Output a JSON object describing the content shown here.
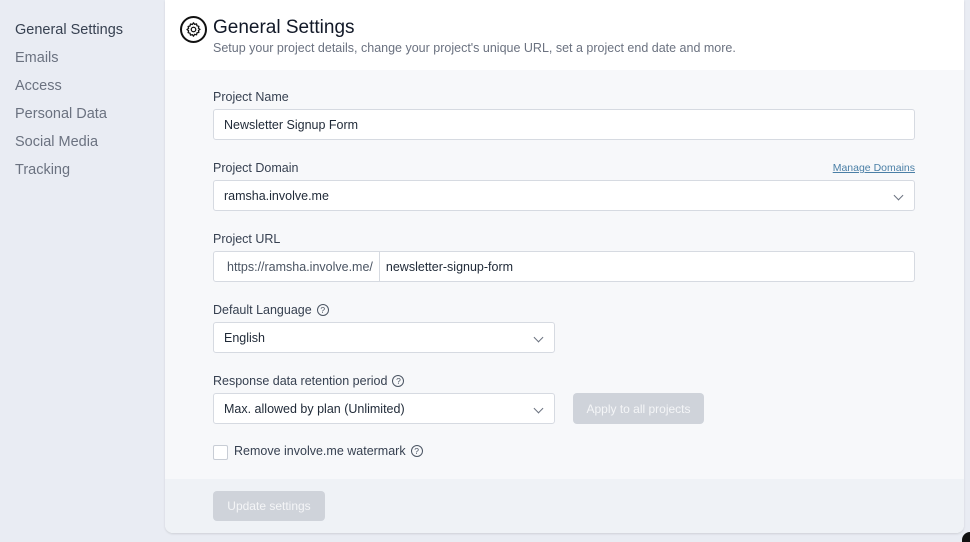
{
  "sidebar": {
    "items": [
      {
        "label": "General Settings",
        "active": true
      },
      {
        "label": "Emails",
        "active": false
      },
      {
        "label": "Access",
        "active": false
      },
      {
        "label": "Personal Data",
        "active": false
      },
      {
        "label": "Social Media",
        "active": false
      },
      {
        "label": "Tracking",
        "active": false
      }
    ]
  },
  "header": {
    "icon": "gear-icon",
    "title": "General Settings",
    "subtitle": "Setup your project details, change your project's unique URL, set a project end date and more."
  },
  "form": {
    "project_name": {
      "label": "Project Name",
      "value": "Newsletter Signup Form"
    },
    "project_domain": {
      "label": "Project Domain",
      "value": "ramsha.involve.me",
      "link": "Manage Domains"
    },
    "project_url": {
      "label": "Project URL",
      "prefix": "https://ramsha.involve.me/",
      "value": "newsletter-signup-form"
    },
    "default_language": {
      "label": "Default Language",
      "value": "English",
      "help": "?"
    },
    "retention": {
      "label": "Response data retention period",
      "value": "Max. allowed by plan (Unlimited)",
      "help": "?",
      "apply_button": "Apply to all projects"
    },
    "watermark": {
      "label": "Remove involve.me watermark",
      "checked": false,
      "help": "?"
    }
  },
  "footer": {
    "update_button": "Update settings"
  },
  "colors": {
    "link": "#4a7fa6",
    "disabled_button": "#cfd3da",
    "sidebar_bg": "#e9ecf3"
  }
}
